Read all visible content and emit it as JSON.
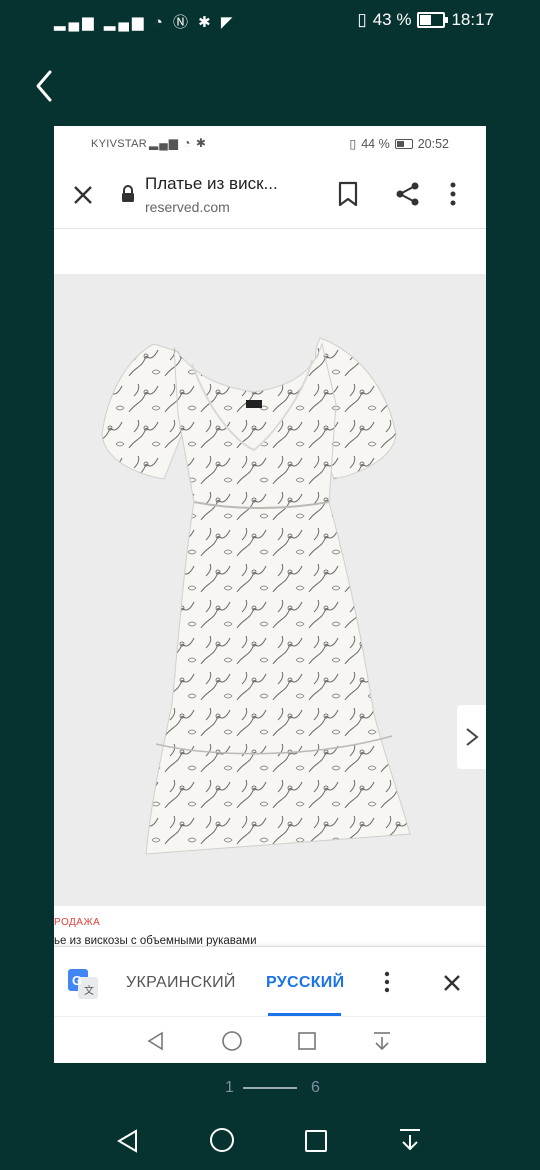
{
  "outer_status": {
    "battery": "43 %",
    "battery_level": 0.43,
    "time": "18:17"
  },
  "inner_status": {
    "carrier": "KYIVSTAR",
    "battery": "44 %",
    "battery_level": 0.44,
    "time": "20:52"
  },
  "browser": {
    "title": "Платье из виск...",
    "url": "reserved.com"
  },
  "product": {
    "sale_label": "РОДАЖА",
    "name": "ье из вискозы с объемными рукавами"
  },
  "translate": {
    "source_lang": "УКРАИНСКИЙ",
    "target_lang": "РУССКИЙ",
    "accent": "#1a73e8"
  },
  "pager": {
    "current": "1",
    "total": "6"
  },
  "icons": [
    "back-icon",
    "close-icon",
    "lock-icon",
    "bookmark-icon",
    "share-icon",
    "more-vert-icon",
    "chevron-right-icon",
    "google-translate-icon",
    "nav-back-icon",
    "nav-home-icon",
    "nav-recents-icon",
    "nav-download-icon"
  ]
}
